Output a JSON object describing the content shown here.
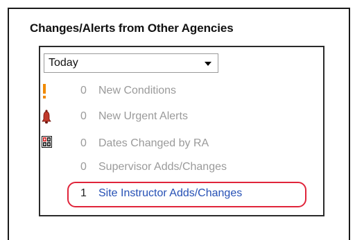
{
  "panel": {
    "title": "Changes/Alerts from Other Agencies"
  },
  "period_select": {
    "selected": "Today"
  },
  "alerts": [
    {
      "icon": "exclamation-icon",
      "count": "0",
      "label": "New Conditions"
    },
    {
      "icon": "bell-icon",
      "count": "0",
      "label": "New Urgent Alerts"
    },
    {
      "icon": "calendar-dates-icon",
      "count": "0",
      "label": "Dates Changed by RA"
    },
    {
      "icon": "",
      "count": "0",
      "label": "Supervisor Adds/Changes"
    },
    {
      "icon": "",
      "count": "1",
      "label": "Site Instructor Adds/Changes"
    }
  ],
  "colors": {
    "exclamation": "#f08a00",
    "bell": "#c0392b",
    "inactive_text": "#9a9a9a",
    "link_text": "#2550b5",
    "highlight": "#e0243a"
  }
}
